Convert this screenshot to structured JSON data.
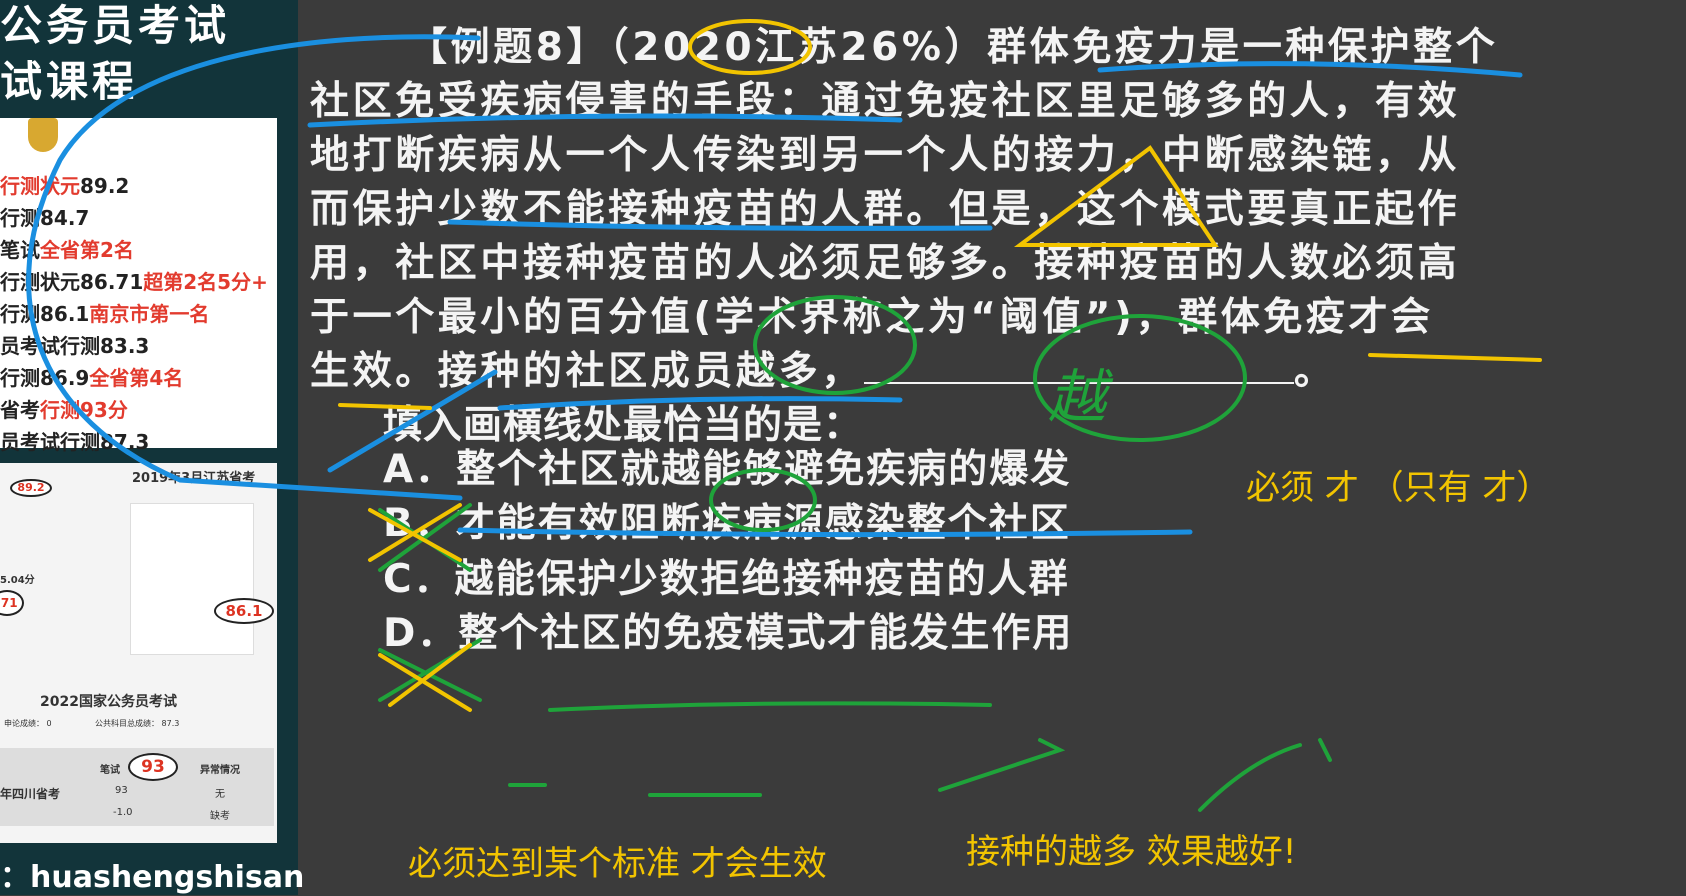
{
  "sidebar": {
    "title_lines": [
      "公务员考试",
      "试课程"
    ],
    "scores": [
      {
        "label": "行测状元",
        "value": "89.2",
        "extra": ""
      },
      {
        "label": "行测",
        "value": "84.7",
        "extra": ""
      },
      {
        "label": "笔试",
        "value": "",
        "extra": "全省第2名"
      },
      {
        "label": "行测状元",
        "value": "86.71",
        "extra": "超第2名5分+"
      },
      {
        "label": "行测",
        "value": "86.1",
        "extra": "南京市第一名"
      },
      {
        "label": "员考试行测",
        "value": "83.3",
        "extra": ""
      },
      {
        "label": "行测",
        "value": "86.9",
        "extra": "全省第4名"
      },
      {
        "label": "省考",
        "value": "",
        "extra": "行测93分"
      },
      {
        "label": "员考试行测",
        "value": "87.3",
        "extra": ""
      }
    ],
    "card": {
      "bubble1": "89.2",
      "bubble2": ".71",
      "bubble3": "86.1",
      "bubble4": "93",
      "small_red": "5.04分",
      "header_2019": "2019年3月江苏省考",
      "header_2022": "2022国家公务员考试",
      "sub_2022_a": "申论成绩： 0",
      "sub_2022_b": "公共科目总成绩： 87.3",
      "table_head": [
        "笔试",
        "异常情况"
      ],
      "table_row1": [
        "年四川省考",
        "93",
        "无"
      ],
      "table_row2": [
        "",
        "-1.0",
        "缺考"
      ]
    },
    "handle": "：huashengshisan"
  },
  "question": {
    "lines": [
      "【例题8】（2020江苏26%）群体免疫力是一种保护整个",
      "社区免受疾病侵害的手段：通过免疫社区里足够多的人，有效",
      "地打断疾病从一个人传染到另一个人的接力，中断感染链，从",
      "而保护少数不能接种疫苗的人群。但是，这个模式要真正起作",
      "用，社区中接种疫苗的人必须足够多。接种疫苗的人数必须高",
      "于一个最小的百分值(学术界称之为“阈值”)，群体免疫才会"
    ],
    "last_line_before": "生效。接种的社区成员越多，",
    "last_line_after": "。",
    "prompt": "填入画横线处最恰当的是：",
    "options": [
      {
        "letter": "A．",
        "text": "整个社区就越能够避免疾病的爆发"
      },
      {
        "letter": "B．",
        "text": "才能有效阻断疾病源感染整个社区"
      },
      {
        "letter": "C．",
        "text": "越能保护少数拒绝接种疫苗的人群"
      },
      {
        "letter": "D．",
        "text": "整个社区的免疫模式才能发生作用"
      }
    ]
  },
  "annotations": {
    "note_right": "必须  才 （只有 才）",
    "note_bottom_left": "必须达到某个标准  才会生效",
    "note_bottom_right": "接种的越多  效果越好!",
    "handwritten_blank": "越"
  },
  "colors": {
    "background": "#3b3b3b",
    "sidebar": "#12343a",
    "note": "#f2c400",
    "blue_ink": "#1a8fe0",
    "green_ink": "#1fa33a",
    "yellow_ink": "#f2c400"
  }
}
